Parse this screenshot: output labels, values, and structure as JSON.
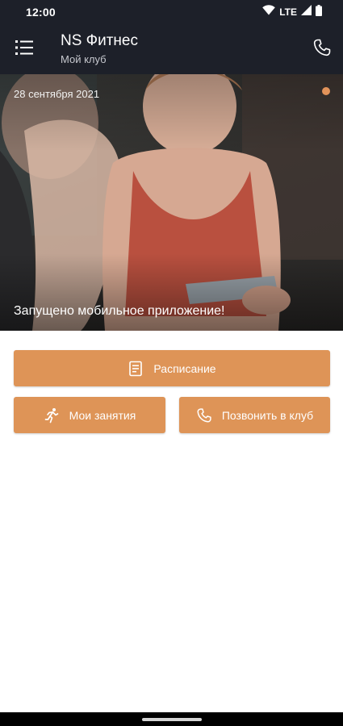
{
  "status_bar": {
    "time": "12:00",
    "network": "LTE",
    "icons": [
      "wifi-icon",
      "signal-icon",
      "battery-icon"
    ]
  },
  "app_bar": {
    "title": "NS Фитнес",
    "subtitle": "Мой клуб",
    "menu_icon": "menu-list-icon",
    "call_icon": "phone-icon"
  },
  "hero": {
    "date": "28 сентября 2021",
    "caption": "Запущено мобильное приложение!",
    "carousel_indicator_color": "#e2935a"
  },
  "actions": {
    "schedule_label": "Расписание",
    "my_classes_label": "Мои занятия",
    "call_club_label": "Позвонить в клуб"
  },
  "colors": {
    "app_bar_bg": "#1d2029",
    "accent": "#de9457",
    "background": "#ffffff"
  }
}
